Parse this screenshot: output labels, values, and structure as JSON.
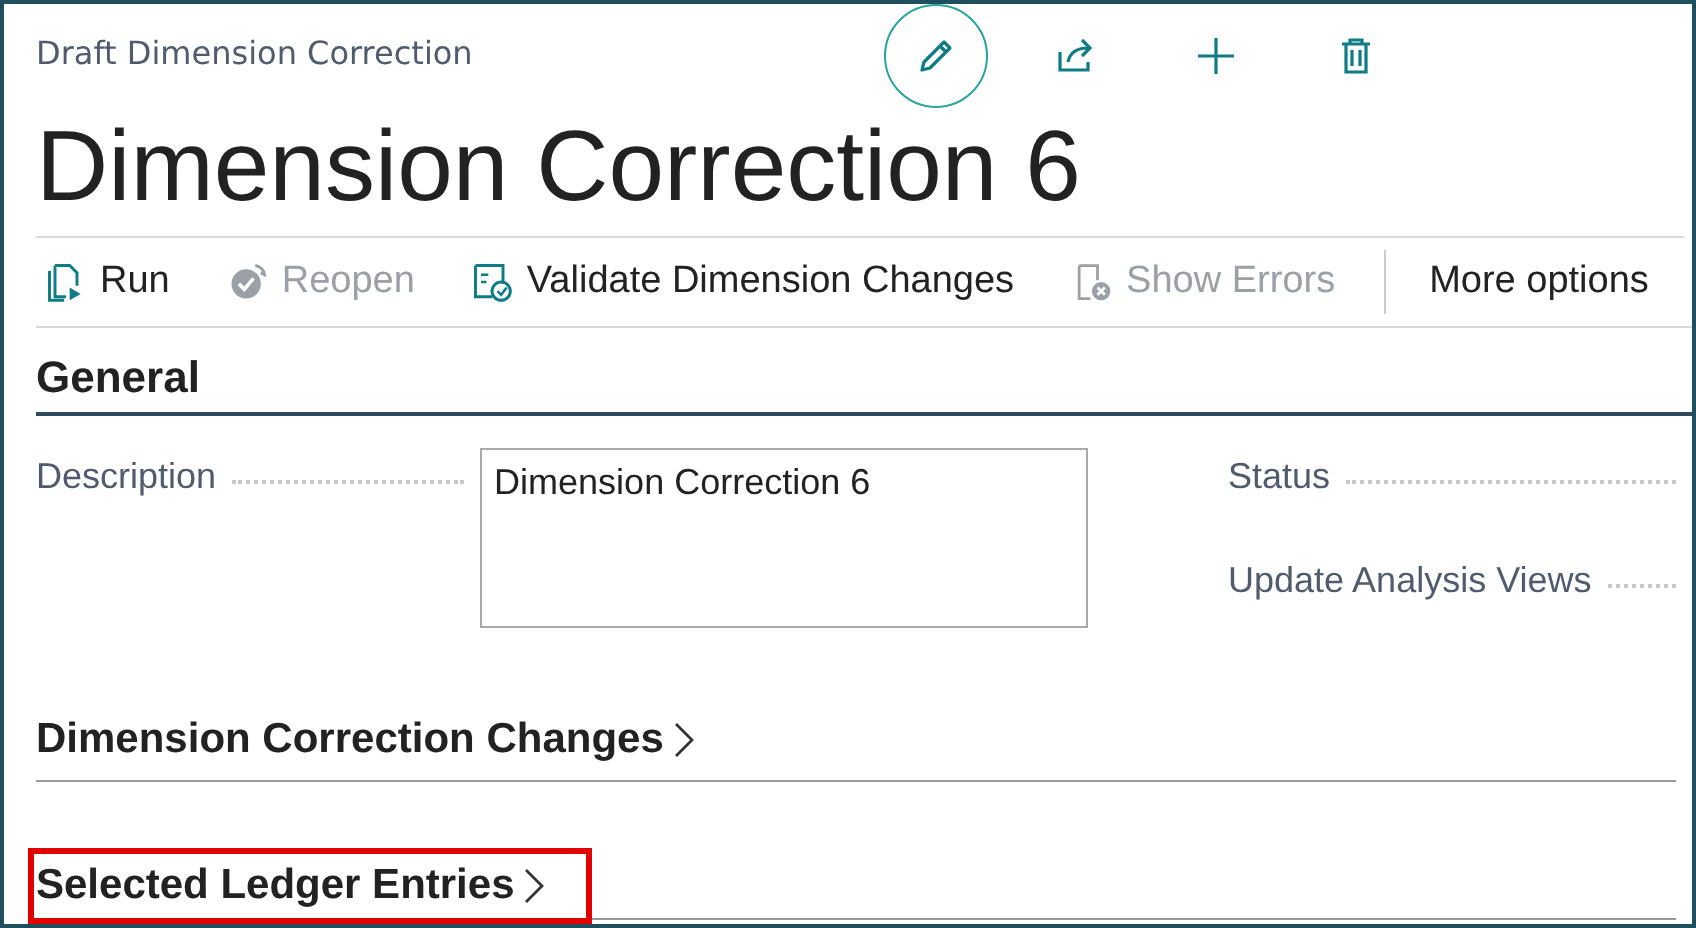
{
  "caption": "Draft Dimension Correction",
  "header_actions": [
    {
      "kind": "edit",
      "selected": true
    },
    {
      "kind": "share",
      "selected": false
    },
    {
      "kind": "new",
      "selected": false
    },
    {
      "kind": "delete",
      "selected": false
    }
  ],
  "title": "Dimension Correction 6",
  "actions": [
    {
      "kind": "run",
      "label": "Run",
      "disabled": false
    },
    {
      "kind": "reopen",
      "label": "Reopen",
      "disabled": true
    },
    {
      "kind": "validate",
      "label": "Validate Dimension Changes",
      "disabled": false
    },
    {
      "kind": "errors",
      "label": "Show Errors",
      "disabled": true
    },
    {
      "kind": "more",
      "label": "More options",
      "disabled": false
    }
  ],
  "general": {
    "heading": "General",
    "fields": [
      {
        "label": "Description",
        "value": "Dimension Correction 6"
      }
    ],
    "right_fields": [
      {
        "label": "Status"
      },
      {
        "label": "Update Analysis Views"
      }
    ]
  },
  "sections": [
    {
      "heading": "Dimension Correction Changes",
      "highlighted": false
    },
    {
      "heading": "Selected Ledger Entries",
      "highlighted": true
    }
  ]
}
